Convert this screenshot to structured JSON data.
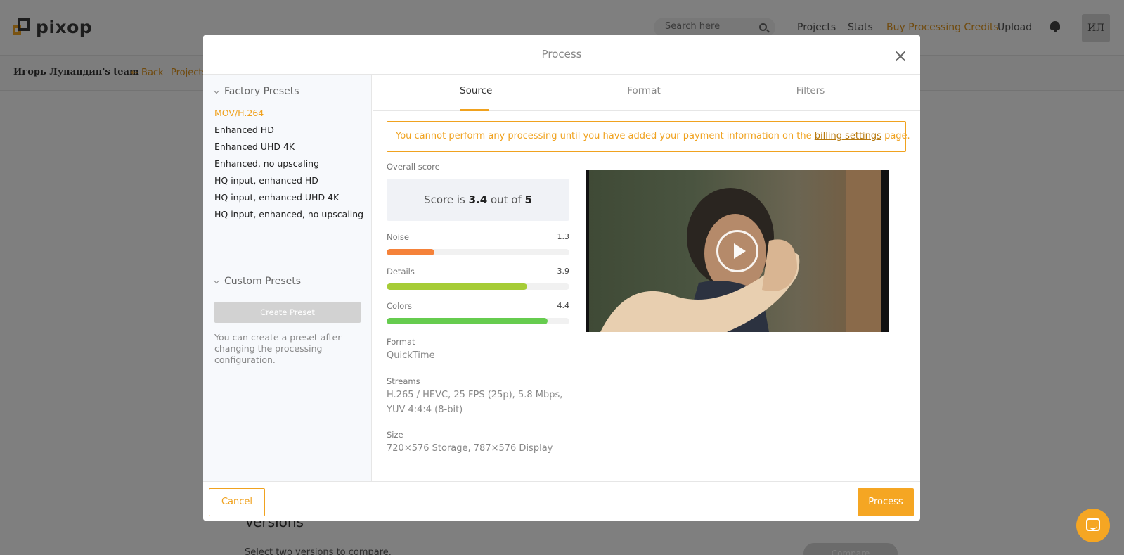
{
  "app": {
    "logo_text": "pixop",
    "search_placeholder": "Search here",
    "nav": {
      "projects": "Projects",
      "stats": "Stats",
      "buy_credits": "Buy Processing Credits",
      "upload": "Upload"
    },
    "avatar_initials": "ИЛ",
    "team_name": "Игорь Лупандин's team",
    "back_label": "Back",
    "breadcrumb": "Projects",
    "versions_title": "Versions",
    "versions_hint": "Select two versions to compare.",
    "compare_label": "Compare"
  },
  "modal": {
    "title": "Process",
    "factory_presets_title": "Factory Presets",
    "factory_presets": [
      {
        "label": "MOV/H.264",
        "active": true
      },
      {
        "label": "Enhanced HD",
        "active": false
      },
      {
        "label": "Enhanced UHD 4K",
        "active": false
      },
      {
        "label": "Enhanced, no upscaling",
        "active": false
      },
      {
        "label": "HQ input, enhanced HD",
        "active": false
      },
      {
        "label": "HQ input, enhanced UHD 4K",
        "active": false
      },
      {
        "label": "HQ input, enhanced, no upscaling",
        "active": false
      }
    ],
    "custom_presets_title": "Custom Presets",
    "create_preset_label": "Create Preset",
    "create_preset_note": "You can create a preset after changing the processing configuration.",
    "tabs": [
      {
        "label": "Source",
        "active": true
      },
      {
        "label": "Format",
        "active": false
      },
      {
        "label": "Filters",
        "active": false
      }
    ],
    "alert": {
      "text_before": "You cannot perform any processing until you have added your payment information on the ",
      "link": "billing settings",
      "text_after": " page."
    },
    "overall_score_label": "Overall score",
    "score": {
      "prefix": "Score is ",
      "value": "3.4",
      "middle": " out of ",
      "max": "5"
    },
    "metrics": [
      {
        "name": "Noise",
        "value": "1.3",
        "fill": 0.26,
        "color": "#f5823a"
      },
      {
        "name": "Details",
        "value": "3.9",
        "fill": 0.77,
        "color": "#a6cc37"
      },
      {
        "name": "Colors",
        "value": "4.4",
        "fill": 0.88,
        "color": "#66cc4f"
      }
    ],
    "format_label": "Format",
    "format_value": "QuickTime",
    "streams_label": "Streams",
    "streams_value": "H.265 / HEVC, 25 FPS (25p), 5.8 Mbps, YUV 4:4:4 (8-bit)",
    "size_label": "Size",
    "size_value": "720×576 Storage, 787×576 Display",
    "cancel_label": "Cancel",
    "process_label": "Process"
  },
  "colors": {
    "accent": "#f5a623",
    "link": "#e0951c"
  }
}
